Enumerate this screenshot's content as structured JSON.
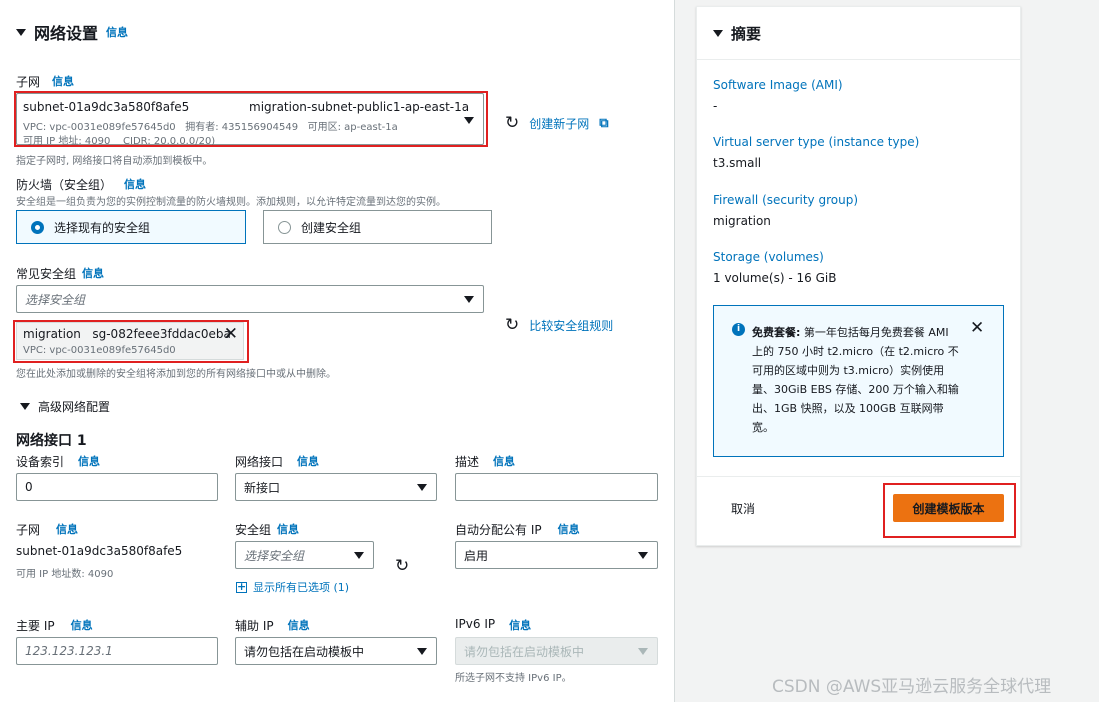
{
  "network": {
    "title": "网络设置",
    "info": "信息",
    "subnet": {
      "label": "子网",
      "id": "subnet-01a9dc3a580f8afe5",
      "name": "migration-subnet-public1-ap-east-1a",
      "detail1": "VPC: vpc-0031e089fe57645d0   拥有者: 435156904549   可用区: ap-east-1a",
      "detail2": "可用 IP 地址: 4090    CIDR: 20.0.0.0/20)",
      "create_link": "创建新子网",
      "hint": "指定子网时, 网络接口将自动添加到模板中。"
    },
    "firewall": {
      "label": "防火墙（安全组）",
      "desc": "安全组是一组负责为您的实例控制流量的防火墙规则。添加规则，以允许特定流量到达您的实例。",
      "option_existing": "选择现有的安全组",
      "option_create": "创建安全组"
    },
    "common_sg": {
      "label": "常见安全组",
      "placeholder": "选择安全组",
      "compare_link": "比较安全组规则",
      "selected_name": "migration   sg-082feee3fddac0eba",
      "selected_vpc": "VPC: vpc-0031e089fe57645d0",
      "hint": "您在此处添加或删除的安全组将添加到您的所有网络接口中或从中删除。"
    },
    "advanced": {
      "title": "高级网络配置",
      "ni_title": "网络接口 1",
      "device_index": {
        "label": "设备索引",
        "value": "0"
      },
      "network_interface": {
        "label": "网络接口",
        "value": "新接口"
      },
      "description": {
        "label": "描述",
        "value": ""
      },
      "subnet": {
        "label": "子网",
        "value": "subnet-01a9dc3a580f8afe5",
        "sub": "可用 IP 地址数: 4090"
      },
      "security_group": {
        "label": "安全组",
        "placeholder": "选择安全组",
        "show_all": "显示所有已选项 (1)"
      },
      "auto_ip": {
        "label": "自动分配公有 IP",
        "value": "启用"
      },
      "primary_ip": {
        "label": "主要 IP",
        "placeholder": "123.123.123.1"
      },
      "secondary_ip": {
        "label": "辅助 IP",
        "value": "请勿包括在启动模板中"
      },
      "ipv6": {
        "label": "IPv6 IP",
        "value": "请勿包括在启动模板中",
        "hint": "所选子网不支持 IPv6 IP。"
      }
    }
  },
  "summary": {
    "title": "摘要",
    "items": [
      {
        "label": "Software Image (AMI)",
        "value": "-"
      },
      {
        "label": "Virtual server type (instance type)",
        "value": "t3.small"
      },
      {
        "label": "Firewall (security group)",
        "value": "migration"
      },
      {
        "label": "Storage (volumes)",
        "value": "1 volume(s) - 16 GiB"
      }
    ],
    "free_tier": {
      "heading": "免费套餐:",
      "text": "第一年包括每月免费套餐 AMI 上的 750 小时 t2.micro（在 t2.micro 不可用的区域中则为 t3.micro）实例使用量、30GiB EBS 存储、200 万个输入和输出、1GB 快照，以及 100GB 互联网带宽。"
    },
    "cancel": "取消",
    "create": "创建模板版本"
  },
  "watermark": "CSDN @AWS亚马逊云服务全球代理",
  "colors": {
    "link": "#0073bb",
    "primary": "#ec7211",
    "highlight": "#e02020"
  }
}
